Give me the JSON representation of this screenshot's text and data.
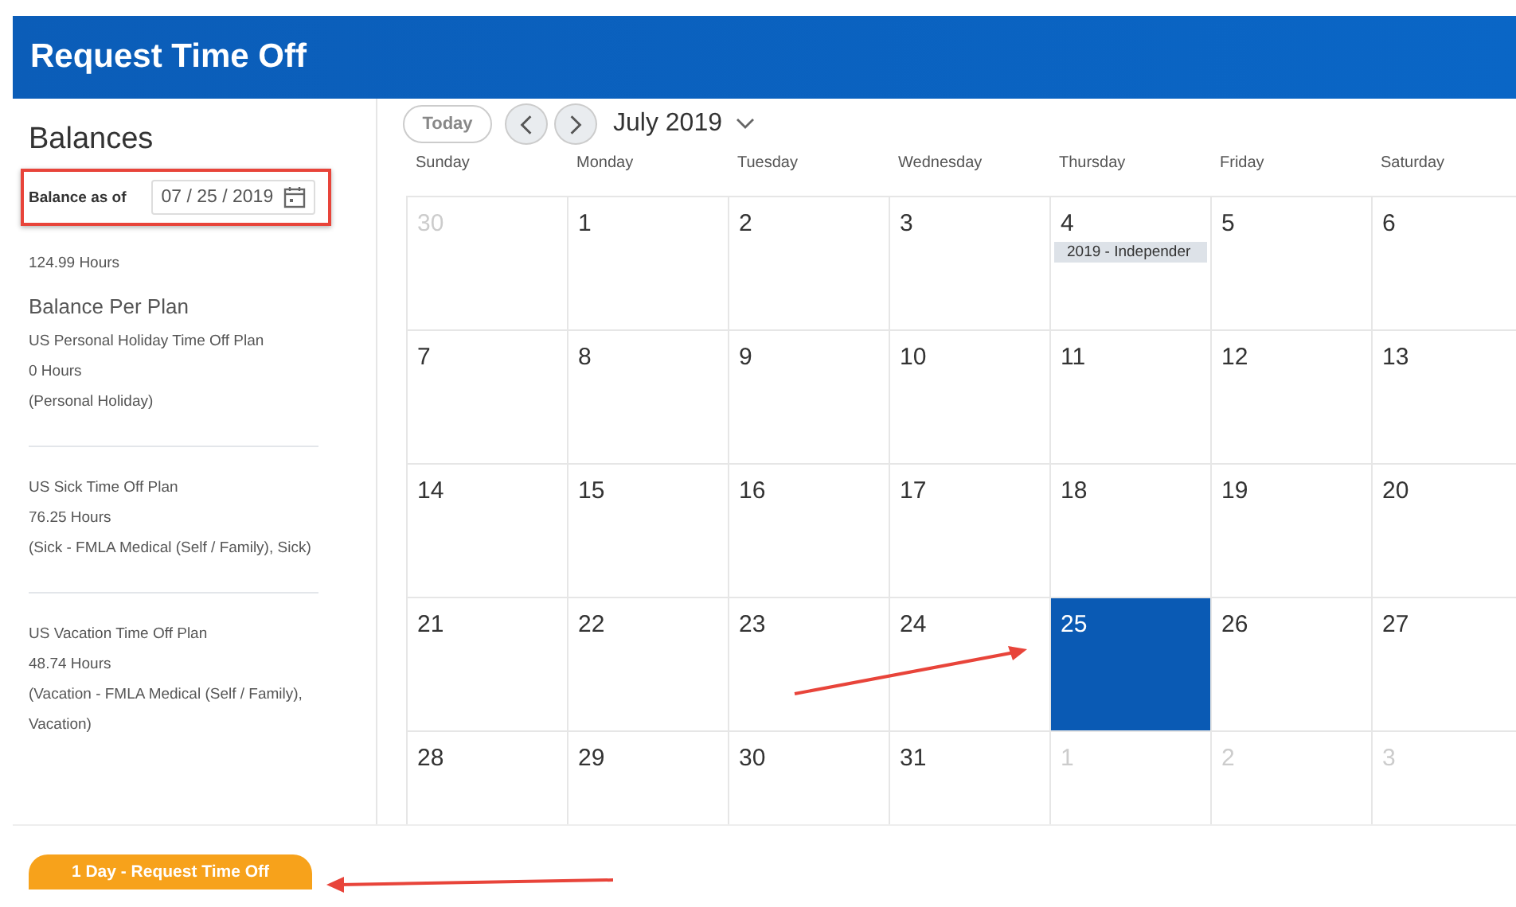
{
  "header": {
    "title": "Request Time Off"
  },
  "balances": {
    "title": "Balances",
    "as_of_label": "Balance as of",
    "as_of_value": "07 / 25 / 2019",
    "total": "124.99 Hours",
    "per_plan_title": "Balance Per Plan",
    "plans": [
      {
        "name": "US Personal Holiday Time Off Plan",
        "hours": "0 Hours",
        "types": "(Personal Holiday)"
      },
      {
        "name": "US Sick Time Off Plan",
        "hours": "76.25 Hours",
        "types": "(Sick - FMLA Medical (Self / Family), Sick)"
      },
      {
        "name": "US Vacation Time Off Plan",
        "hours": "48.74 Hours",
        "types": "(Vacation - FMLA Medical (Self / Family), Vacation)"
      }
    ]
  },
  "calendar": {
    "today_button": "Today",
    "month": "July 2019",
    "weekdays": [
      "Sunday",
      "Monday",
      "Tuesday",
      "Wednesday",
      "Thursday",
      "Friday",
      "Saturday"
    ],
    "weeks": [
      [
        {
          "day": "30",
          "muted": true,
          "selected": false
        },
        {
          "day": "1",
          "muted": false,
          "selected": false
        },
        {
          "day": "2",
          "muted": false,
          "selected": false
        },
        {
          "day": "3",
          "muted": false,
          "selected": false
        },
        {
          "day": "4",
          "muted": false,
          "selected": false,
          "event": "2019 - Independer"
        },
        {
          "day": "5",
          "muted": false,
          "selected": false
        },
        {
          "day": "6",
          "muted": false,
          "selected": false
        }
      ],
      [
        {
          "day": "7",
          "muted": false,
          "selected": false
        },
        {
          "day": "8",
          "muted": false,
          "selected": false
        },
        {
          "day": "9",
          "muted": false,
          "selected": false
        },
        {
          "day": "10",
          "muted": false,
          "selected": false
        },
        {
          "day": "11",
          "muted": false,
          "selected": false
        },
        {
          "day": "12",
          "muted": false,
          "selected": false
        },
        {
          "day": "13",
          "muted": false,
          "selected": false
        }
      ],
      [
        {
          "day": "14",
          "muted": false,
          "selected": false
        },
        {
          "day": "15",
          "muted": false,
          "selected": false
        },
        {
          "day": "16",
          "muted": false,
          "selected": false
        },
        {
          "day": "17",
          "muted": false,
          "selected": false
        },
        {
          "day": "18",
          "muted": false,
          "selected": false
        },
        {
          "day": "19",
          "muted": false,
          "selected": false
        },
        {
          "day": "20",
          "muted": false,
          "selected": false
        }
      ],
      [
        {
          "day": "21",
          "muted": false,
          "selected": false
        },
        {
          "day": "22",
          "muted": false,
          "selected": false
        },
        {
          "day": "23",
          "muted": false,
          "selected": false
        },
        {
          "day": "24",
          "muted": false,
          "selected": false
        },
        {
          "day": "25",
          "muted": false,
          "selected": true
        },
        {
          "day": "26",
          "muted": false,
          "selected": false
        },
        {
          "day": "27",
          "muted": false,
          "selected": false
        }
      ],
      [
        {
          "day": "28",
          "muted": false,
          "selected": false
        },
        {
          "day": "29",
          "muted": false,
          "selected": false
        },
        {
          "day": "30",
          "muted": false,
          "selected": false
        },
        {
          "day": "31",
          "muted": false,
          "selected": false
        },
        {
          "day": "1",
          "muted": true,
          "selected": false
        },
        {
          "day": "2",
          "muted": true,
          "selected": false
        },
        {
          "day": "3",
          "muted": true,
          "selected": false
        }
      ]
    ]
  },
  "request_button": "1 Day - Request Time Off"
}
